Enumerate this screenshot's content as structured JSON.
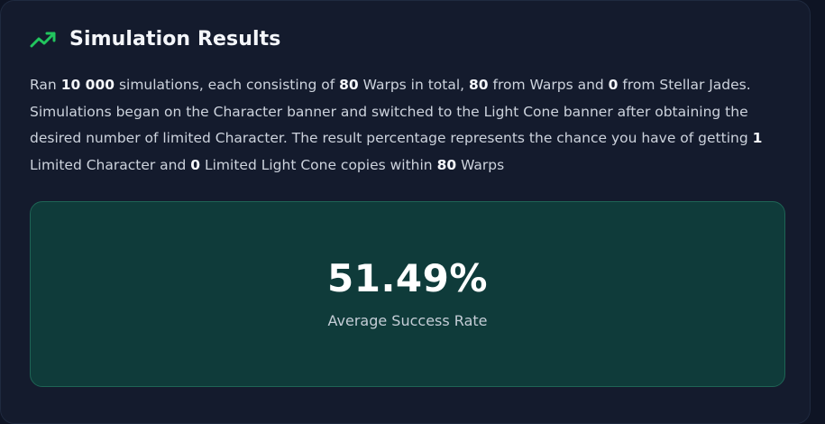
{
  "header": {
    "icon": "trending-up-icon",
    "title": "Simulation Results",
    "accent_color": "#22c55e"
  },
  "description": {
    "p1": "Ran ",
    "simulations": "10 000",
    "p2": " simulations, each consisting of ",
    "total_warps": "80",
    "p3": " Warps in total, ",
    "warps_from_warps": "80",
    "p4": " from Warps and ",
    "warps_from_jades": "0",
    "p5": " from Stellar Jades. Simulations began on the Character banner and switched to the Light Cone banner after obtaining the desired number of limited Character. The result percentage represents the chance you have of getting ",
    "limited_characters": "1",
    "p6": " Limited Character and ",
    "limited_light_cones": "0",
    "p7": " Limited Light Cone copies within ",
    "within_warps": "80",
    "p8": " Warps"
  },
  "result": {
    "rate": "51.49%",
    "label": "Average Success Rate"
  }
}
